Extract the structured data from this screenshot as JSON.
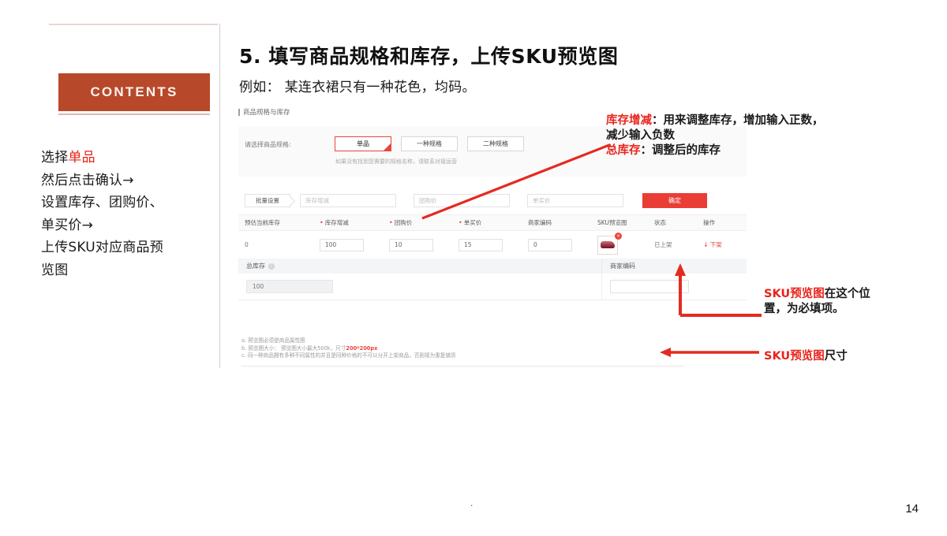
{
  "sidebar": {
    "contents_label": "CONTENTS",
    "bullets": [
      {
        "prefix": "选择",
        "highlight": "单品",
        "suffix": ""
      },
      {
        "prefix": "然后点击确认→",
        "highlight": "",
        "suffix": ""
      },
      {
        "prefix": "设置库存、团购价、",
        "highlight": "",
        "suffix": ""
      },
      {
        "prefix": "单买价→",
        "highlight": "",
        "suffix": ""
      },
      {
        "prefix": "上传SKU对应商品预",
        "highlight": "",
        "suffix": ""
      },
      {
        "prefix": "览图",
        "highlight": "",
        "suffix": ""
      }
    ]
  },
  "header": {
    "title": "5. 填写商品规格和库存，上传SKU预览图",
    "subtitle": "例如： 某连衣裙只有一种花色，均码。",
    "section_label": "商品规格与库存"
  },
  "form": {
    "spec_label": "请选择商品规格:",
    "spec_buttons": [
      "单品",
      "一种规格",
      "二种规格"
    ],
    "spec_selected": "单品",
    "spec_note": "如果没有找到您需要的规格名称，请联系对接运营",
    "batch_tag": "批量设置",
    "batch_placeholders": [
      "库存增减",
      "团购价",
      "单买价"
    ],
    "confirm_label": "确定"
  },
  "table": {
    "headers": [
      {
        "label": "预估当前库存",
        "required": false
      },
      {
        "label": "库存增减",
        "required": true
      },
      {
        "label": "团购价",
        "required": true
      },
      {
        "label": "单买价",
        "required": true
      },
      {
        "label": "商家编码",
        "required": false
      },
      {
        "label": "SKU预览图",
        "required": false
      },
      {
        "label": "状态",
        "required": false
      },
      {
        "label": "操作",
        "required": false
      }
    ],
    "row": {
      "current_stock": "0",
      "stock_change": "100",
      "group_price": "10",
      "single_price": "15",
      "merchant_code": "0",
      "thumb_badge": "×",
      "status": "已上架",
      "action": "下架",
      "action_arrow": "↓"
    }
  },
  "total": {
    "total_stock_label": "总库存",
    "total_stock_info": "i",
    "total_stock_value": "100",
    "merchant_code_label": "商家编码",
    "merchant_code_value": ""
  },
  "notes": [
    {
      "marker": "a.",
      "text": "预览图必须是商品属性图",
      "strong": ""
    },
    {
      "marker": "b.",
      "text": "预览图大小： 预览图大小最大500k，尺寸",
      "strong": "200*200px"
    },
    {
      "marker": "c.",
      "text": "同一种商品拥有多种不同属性的并且是同种价格的不可以分开上架商品，否则视为重复铺货",
      "strong": ""
    }
  ],
  "annotations": {
    "stock": {
      "key": "库存增减",
      "sep": "：",
      "line1": "用来调整库存，增加输入正数，",
      "line2": "减少输入负数"
    },
    "total": {
      "key": "总库存",
      "sep": "：",
      "line1": "调整后的库存"
    },
    "sku_position": {
      "key": "SKU预览图",
      "line1": "在这个位",
      "line2": "置，为必填项。"
    },
    "sku_size": {
      "key": "SKU预览图",
      "line1": "尺寸"
    }
  },
  "footer": {
    "page_number": "14",
    "center_mark": "."
  },
  "colors": {
    "brand_orange": "#b8482a",
    "accent_red": "#e8231a",
    "button_red": "#ea3d35"
  }
}
